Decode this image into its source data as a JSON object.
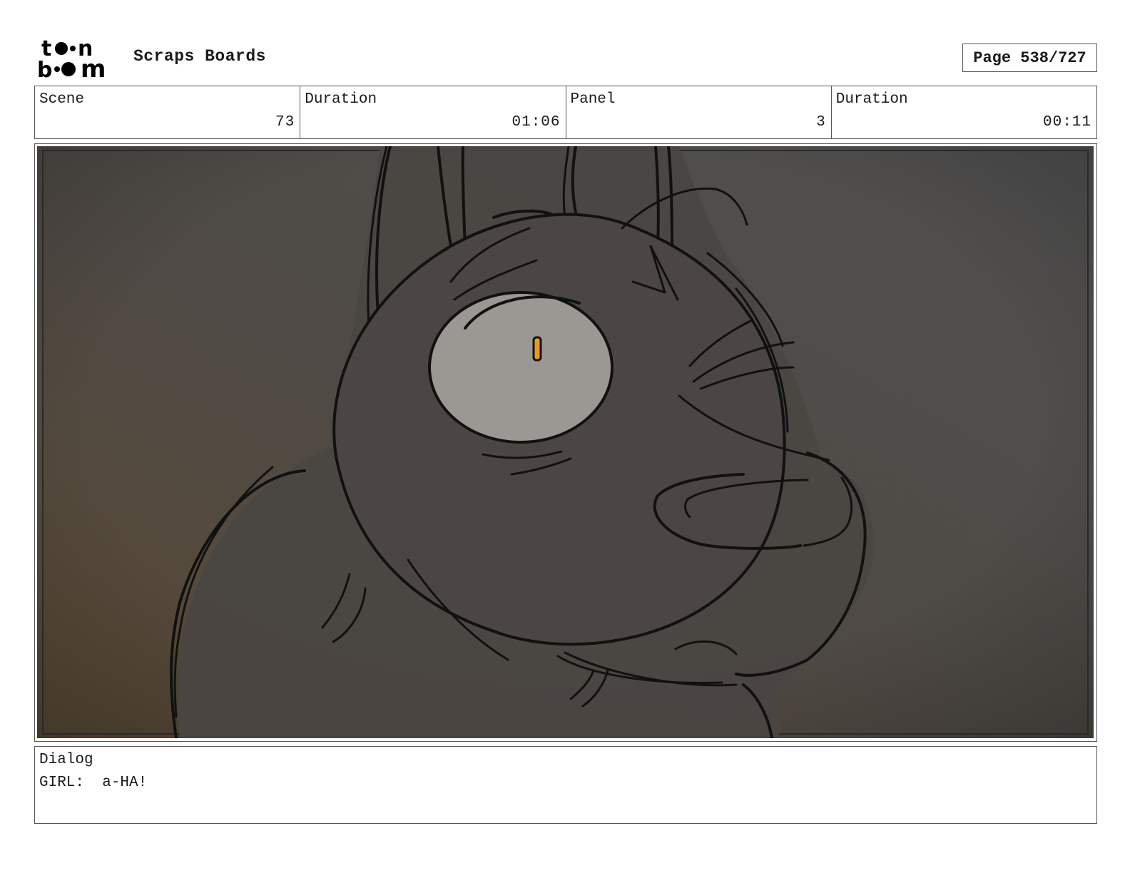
{
  "header": {
    "logo_text": "toon boom",
    "title": "Scraps Boards",
    "page": "Page 538/727"
  },
  "info": {
    "scene_label": "Scene",
    "scene_value": "73",
    "scene_duration_label": "Duration",
    "scene_duration_value": "01:06",
    "panel_label": "Panel",
    "panel_value": "3",
    "panel_duration_label": "Duration",
    "panel_duration_value": "00:11"
  },
  "dialog": {
    "label": "Dialog",
    "text": "GIRL:  a-HA!"
  },
  "colors": {
    "frame_border": "#555555",
    "bg_dark": "#3a3a3a",
    "bg_warm": "#5a4a36",
    "creature_fill": "#4a4543",
    "eye_fill": "#9a9691",
    "pupil_fill": "#e89a1e",
    "line": "#111111"
  }
}
